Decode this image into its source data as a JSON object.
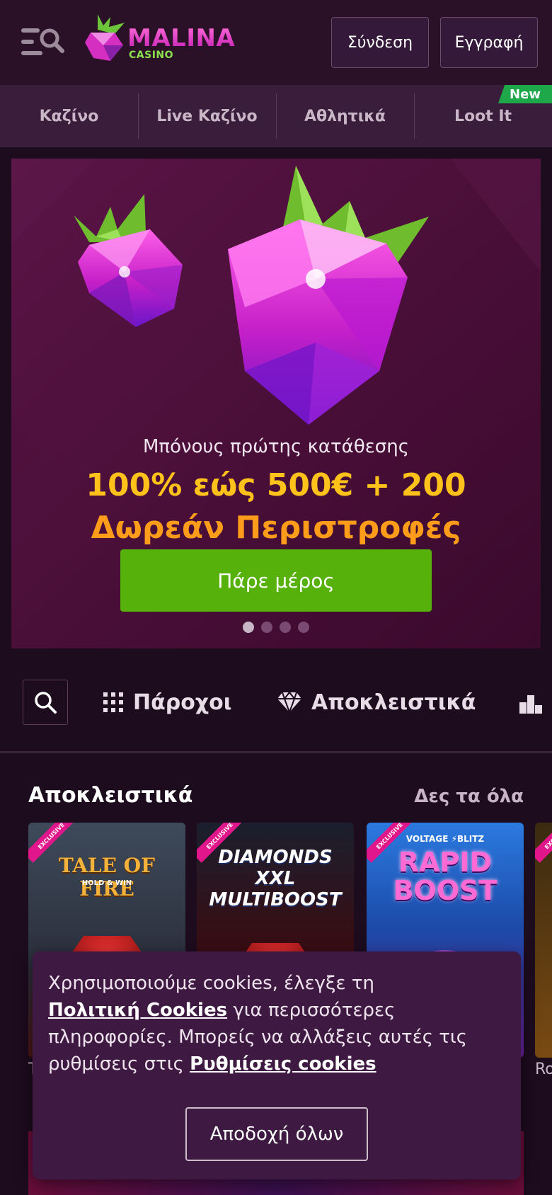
{
  "header": {
    "logo_text": "MALINA",
    "logo_sub": "CASINO",
    "login_label": "Σύνδεση",
    "register_label": "Εγγραφή"
  },
  "nav": {
    "items": [
      {
        "label": "Καζίνο"
      },
      {
        "label": "Live Καζίνο"
      },
      {
        "label": "Αθλητικά"
      },
      {
        "label": "Loot It",
        "badge": "New"
      }
    ]
  },
  "hero": {
    "subtitle": "Μπόνους πρώτης κατάθεσης",
    "line1": "100% εώς 500€ + 200",
    "line2": "Δωρεάν Περιστροφές",
    "cta": "Πάρε μέρος",
    "slides_total": 4,
    "active_slide": 1
  },
  "filters": {
    "providers": "Πάροχοι",
    "exclusive": "Αποκλειστικά"
  },
  "section": {
    "title": "Αποκλειστικά",
    "see_all": "Δες τα όλα",
    "badge": "EXCLUSIVE",
    "games": [
      {
        "title": "TALE OF FIRE",
        "subtitle": "HOLD & WIN",
        "label_start": "T"
      },
      {
        "title": "DIAMONDS XXL MULTIBOOST"
      },
      {
        "brand": "VOLTAGE ⚡BLITZ",
        "title": "RAPID BOOST"
      },
      {
        "label_start": "Ro"
      }
    ]
  },
  "cookie": {
    "text1": "Χρησιμοποιούμε cookies, έλεγξε τη",
    "link1": "Πολιτική Cookies",
    "text2": "για περισσότερες πληροφορίες. Μπορείς να αλλάξεις αυτές τις ρυθμίσεις στις",
    "link2": "Ρυθμίσεις cookies",
    "accept": "Αποδοχή όλων"
  },
  "colors": {
    "background": "#1d0b1e",
    "accent_green": "#56b10a",
    "bonus_yellow": "#ffc21a",
    "bonus_orange": "#ff9d1a",
    "brand_pink": "#e2168b"
  },
  "icons": {
    "menu": "menu-search-icon",
    "search": "search-icon",
    "providers": "grid-icon",
    "exclusive": "diamond-icon",
    "more": "podium-icon"
  }
}
